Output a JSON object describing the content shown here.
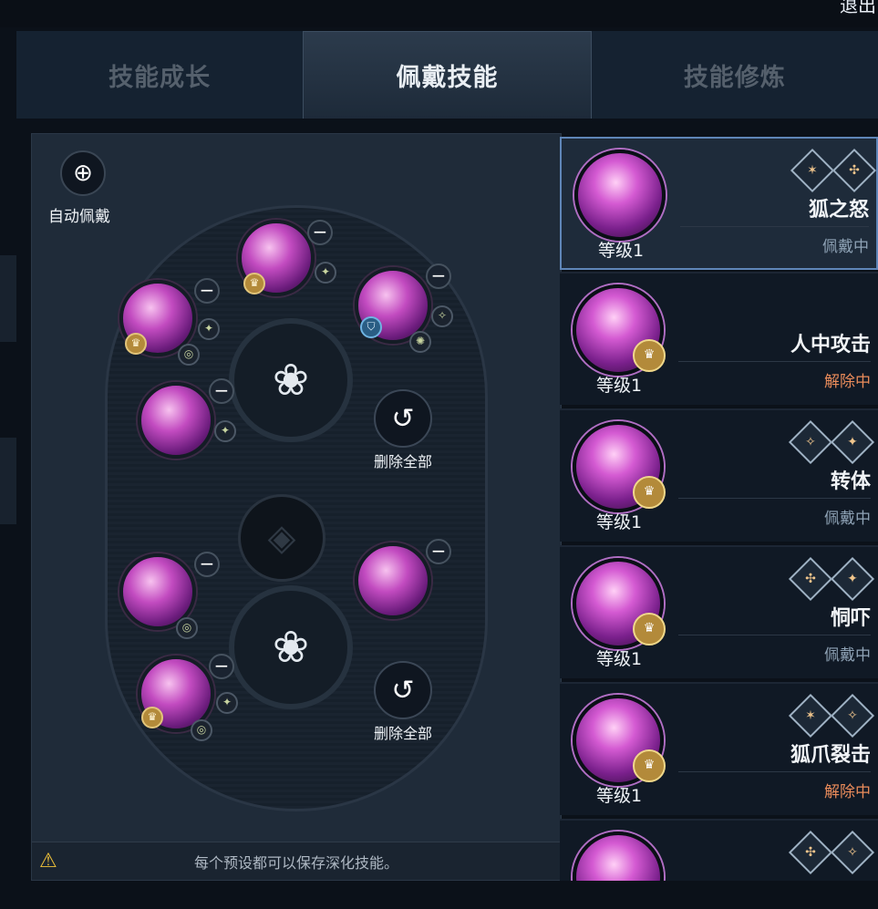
{
  "header": {
    "exit_label": "退出"
  },
  "tabs": [
    {
      "label": "技能成长",
      "active": false
    },
    {
      "label": "佩戴技能",
      "active": true
    },
    {
      "label": "技能修炼",
      "active": false
    }
  ],
  "left_panel": {
    "auto_equip_label": "自动佩戴",
    "upper_reset_label": "删除全部",
    "lower_reset_label": "删除全部",
    "tip_text": "每个预设都可以保存深化技能。"
  },
  "skills": [
    {
      "name": "狐之怒",
      "level": "等级1",
      "status": "佩戴中",
      "state": "on"
    },
    {
      "name": "人中攻击",
      "level": "等级1",
      "status": "解除中",
      "state": "off"
    },
    {
      "name": "转体",
      "level": "等级1",
      "status": "佩戴中",
      "state": "on"
    },
    {
      "name": "恫吓",
      "level": "等级1",
      "status": "佩戴中",
      "state": "on"
    },
    {
      "name": "狐爪裂击",
      "level": "等级1",
      "status": "解除中",
      "state": "off"
    },
    {
      "name": "",
      "level": "",
      "status": "",
      "state": "on"
    }
  ],
  "colors": {
    "accent_selected": "#5f86b8",
    "equipped": "#8fa3b6",
    "unequipped": "#e98b5a",
    "warning": "#f0c23a"
  },
  "icons": [
    "plus-cycle-icon",
    "reset-icon",
    "fox-emblem-icon",
    "diamond-emblem-icon",
    "warning-icon",
    "minus-icon"
  ]
}
